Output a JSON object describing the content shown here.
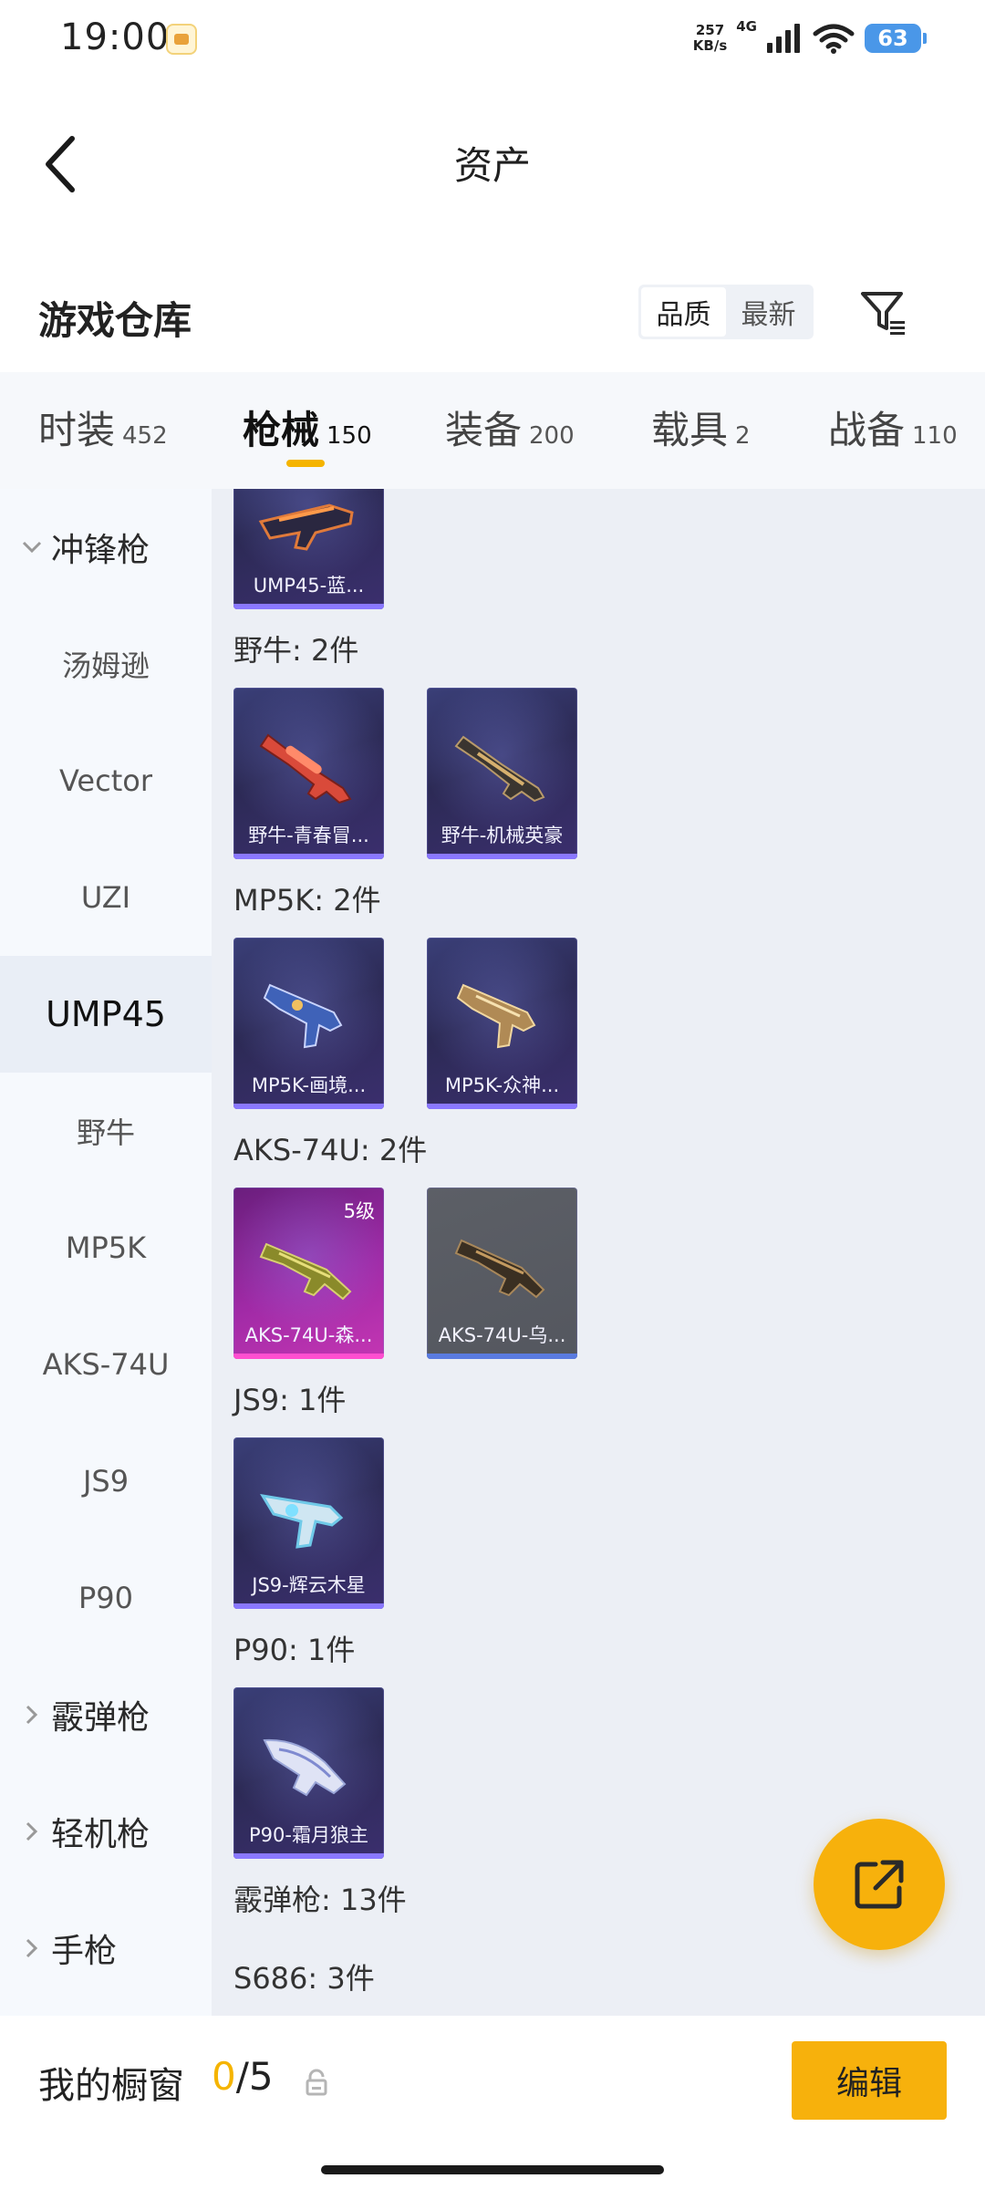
{
  "status_bar": {
    "time": "19:00",
    "net_speed_value": "257",
    "net_speed_unit": "KB/s",
    "network_type": "4G",
    "battery": "63"
  },
  "header": {
    "title": "资产"
  },
  "warehouse": {
    "title": "游戏仓库",
    "sort_options": [
      "品质",
      "最新"
    ],
    "active_sort": "品质"
  },
  "tabs": [
    {
      "label": "时装",
      "count": "452"
    },
    {
      "label": "枪械",
      "count": "150",
      "active": true
    },
    {
      "label": "装备",
      "count": "200"
    },
    {
      "label": "载具",
      "count": "2"
    },
    {
      "label": "战备",
      "count": "110"
    }
  ],
  "sidebar": {
    "items": [
      {
        "label": "冲锋枪",
        "type": "group",
        "expanded": true
      },
      {
        "label": "汤姆逊",
        "type": "item"
      },
      {
        "label": "Vector",
        "type": "item"
      },
      {
        "label": "UZI",
        "type": "item"
      },
      {
        "label": "UMP45",
        "type": "item",
        "selected": true
      },
      {
        "label": "野牛",
        "type": "item"
      },
      {
        "label": "MP5K",
        "type": "item"
      },
      {
        "label": "AKS-74U",
        "type": "item"
      },
      {
        "label": "JS9",
        "type": "item"
      },
      {
        "label": "P90",
        "type": "item"
      },
      {
        "label": "霰弹枪",
        "type": "group",
        "expanded": false
      },
      {
        "label": "轻机枪",
        "type": "group",
        "expanded": false
      },
      {
        "label": "手枪",
        "type": "group",
        "expanded": false
      }
    ]
  },
  "content": {
    "top_card": {
      "name": "UMP45-蓝..."
    },
    "groups": [
      {
        "label": "野牛: 2件",
        "cards": [
          {
            "name": "野牛-青春冒...",
            "rarity": "purple"
          },
          {
            "name": "野牛-机械英豪",
            "rarity": "purple"
          }
        ]
      },
      {
        "label": "MP5K: 2件",
        "cards": [
          {
            "name": "MP5K-画境...",
            "rarity": "purple"
          },
          {
            "name": "MP5K-众神...",
            "rarity": "purple"
          }
        ]
      },
      {
        "label": "AKS-74U: 2件",
        "cards": [
          {
            "name": "AKS-74U-森...",
            "rarity": "pink",
            "level": "5级"
          },
          {
            "name": "AKS-74U-乌...",
            "rarity": "gray"
          }
        ]
      },
      {
        "label": "JS9: 1件",
        "cards": [
          {
            "name": "JS9-辉云木星",
            "rarity": "purple"
          }
        ]
      },
      {
        "label": "P90: 1件",
        "cards": [
          {
            "name": "P90-霜月狼主",
            "rarity": "purple"
          }
        ]
      },
      {
        "label": "霰弹枪: 13件",
        "cards": []
      },
      {
        "label": "S686: 3件",
        "cards": []
      }
    ]
  },
  "bottom_bar": {
    "showcase_label": "我的橱窗",
    "showcase_current": "0",
    "showcase_total": "/5",
    "edit_label": "编辑"
  },
  "colors": {
    "accent": "#f7b10c",
    "tab_underline": "#f5b400",
    "selected_side_bg": "#e9eef6",
    "content_bg": "#eceff5"
  }
}
